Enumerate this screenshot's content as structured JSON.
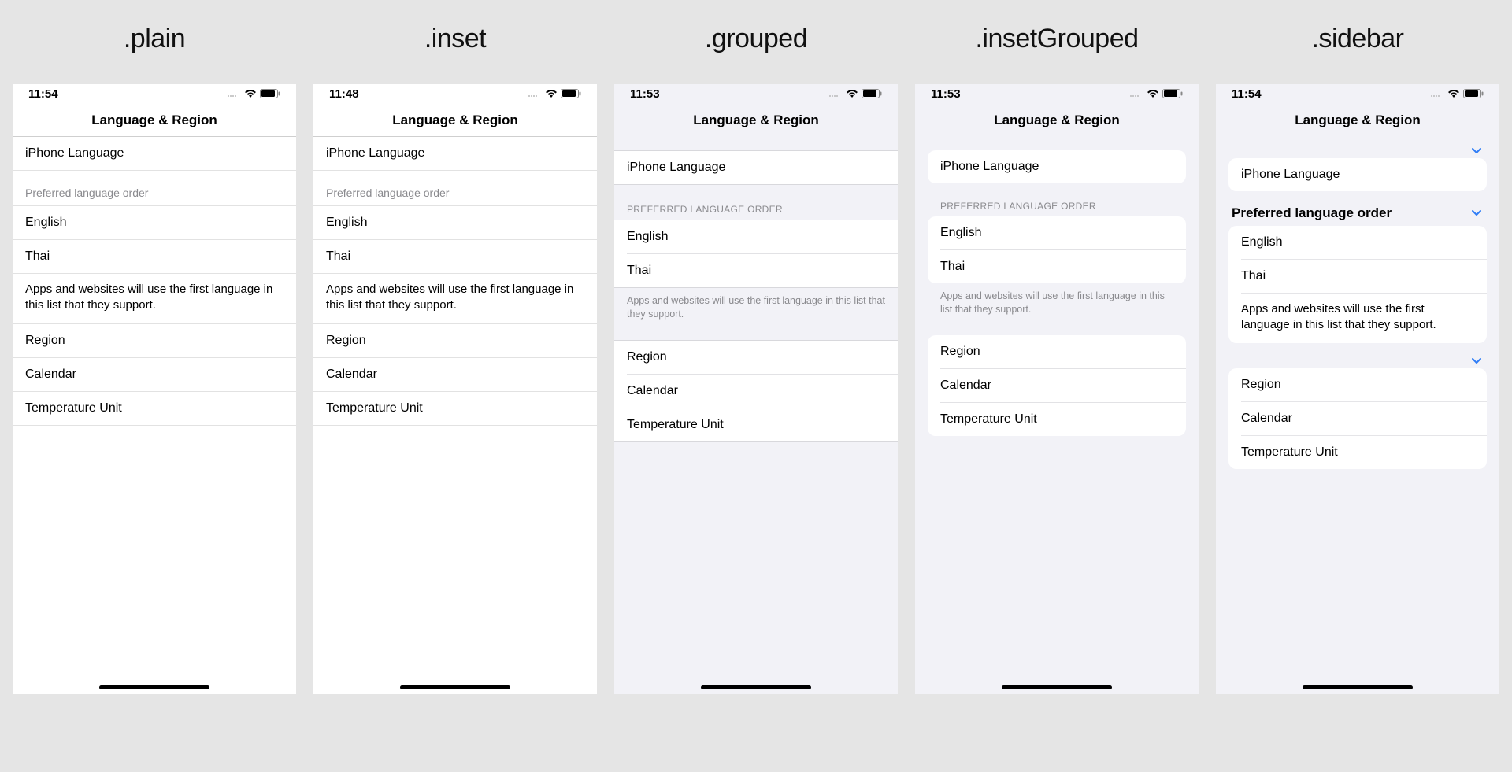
{
  "styles": {
    "plain": ".plain",
    "inset": ".inset",
    "grouped": ".grouped",
    "insetGrouped": ".insetGrouped",
    "sidebar": ".sidebar"
  },
  "navTitle": "Language & Region",
  "times": {
    "plain": "11:54",
    "inset": "11:48",
    "grouped": "11:53",
    "insetGrouped": "11:53",
    "sidebar": "11:54"
  },
  "rows": {
    "iphoneLanguage": "iPhone Language",
    "english": "English",
    "thai": "Thai",
    "region": "Region",
    "calendar": "Calendar",
    "temperature": "Temperature Unit"
  },
  "sectionHeaders": {
    "preferredPlain": "Preferred language order",
    "preferredGrouped": "PREFERRED LANGUAGE ORDER",
    "preferredSidebar": "Preferred language order"
  },
  "footerText": "Apps and websites will use the first language in this list that they support."
}
